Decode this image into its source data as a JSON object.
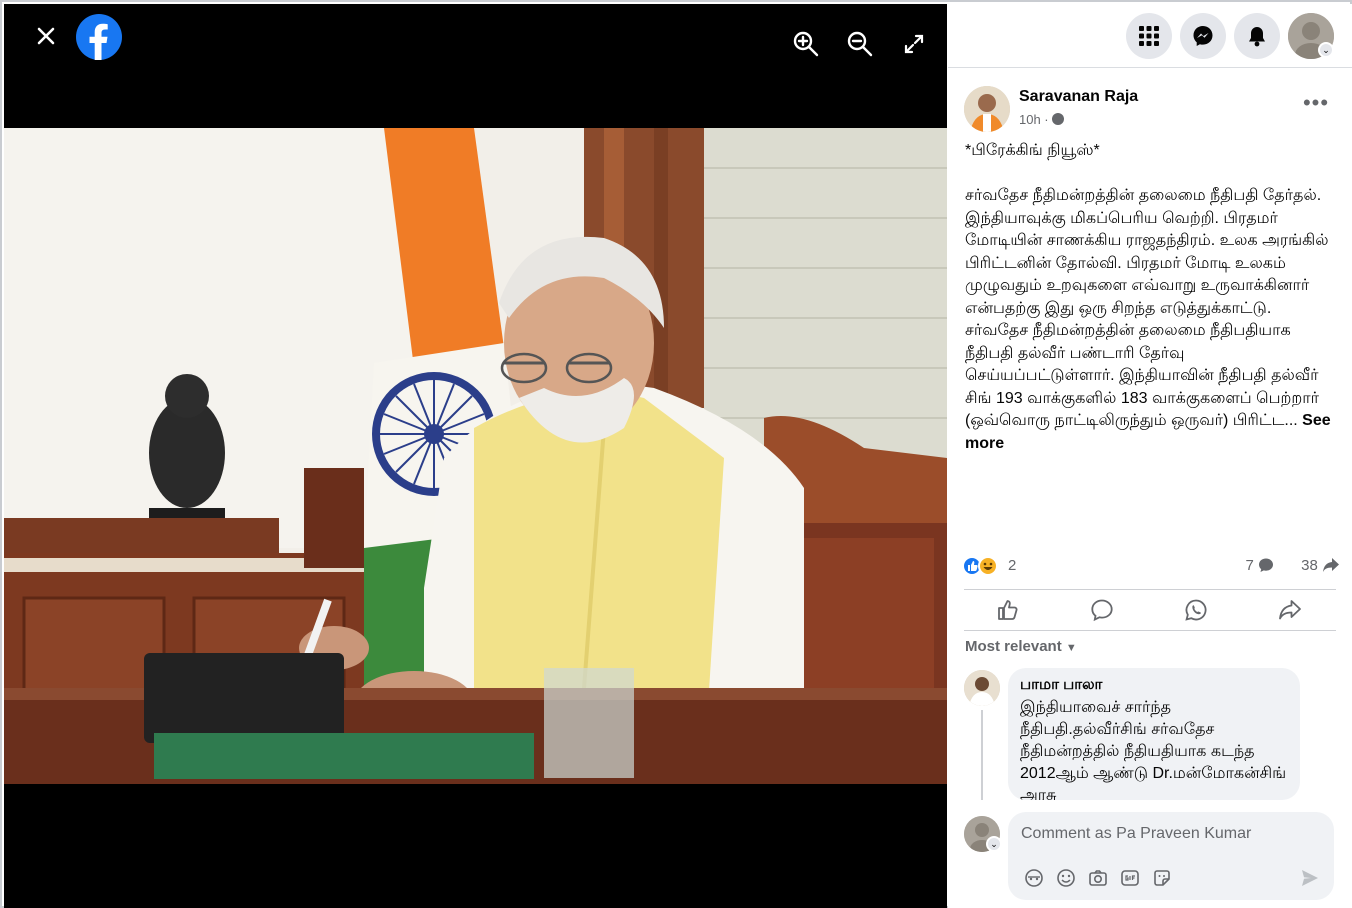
{
  "post": {
    "author": "Saravanan Raja",
    "time": "10h ·",
    "text": "*பிரேக்கிங் நியூஸ்*\n\nசர்வதேச நீதிமன்றத்தின் தலைமை நீதிபதி தேர்தல். இந்தியாவுக்கு மிகப்பெரிய வெற்றி. பிரதமர் மோடியின் சாணக்கிய ராஜதந்திரம். உலக அரங்கில் பிரிட்டனின் தோல்வி. பிரதமர் மோடி உலகம் முழுவதும் உறவுகளை எவ்வாறு உருவாக்கினார் என்பதற்கு இது ஒரு சிறந்த எடுத்துக்காட்டு. சர்வதேச நீதிமன்றத்தின் தலைமை நீதிபதியாக நீதிபதி தல்வீர் பண்டாரி தேர்வு செய்யப்பட்டுள்ளார். இந்தியாவின் நீதிபதி தல்வீர் சிங் 193 வாக்குகளில் 183 வாக்குகளைப் பெற்றார் (ஒவ்வொரு நாட்டிலிருந்தும் ஒருவர்) பிரிட்ட... ",
    "see_more": "See more",
    "reaction_count": "2",
    "comment_count": "7",
    "share_count": "38"
  },
  "comments": {
    "sort_label": "Most relevant",
    "items": [
      {
        "name": "பாமா பாலா",
        "text": "இந்தியாவைச் சார்ந்த நீதிபதி.தல்வீர்சிங் சர்வதேச நீதிமன்றத்தில் நீதியதியாக கடந்த 2012ஆம் ஆண்டு Dr.மன்மோகன்சிங் அரசு"
      }
    ],
    "composer_placeholder": "Comment as Pa Praveen Kumar"
  },
  "icons": {
    "close": "close-icon",
    "logo": "facebook-logo-icon",
    "zoom_in": "zoom-in-icon",
    "zoom_out": "zoom-out-icon",
    "fullscreen": "fullscreen-icon",
    "menu": "menu-grid-icon",
    "messenger": "messenger-icon",
    "notifications": "bell-icon",
    "like": "like-icon",
    "comment": "comment-icon",
    "whatsapp": "whatsapp-icon",
    "share": "share-icon"
  },
  "colors": {
    "brand": "#1877f2",
    "haha": "#f7b125",
    "secondary_text": "#65676b"
  }
}
